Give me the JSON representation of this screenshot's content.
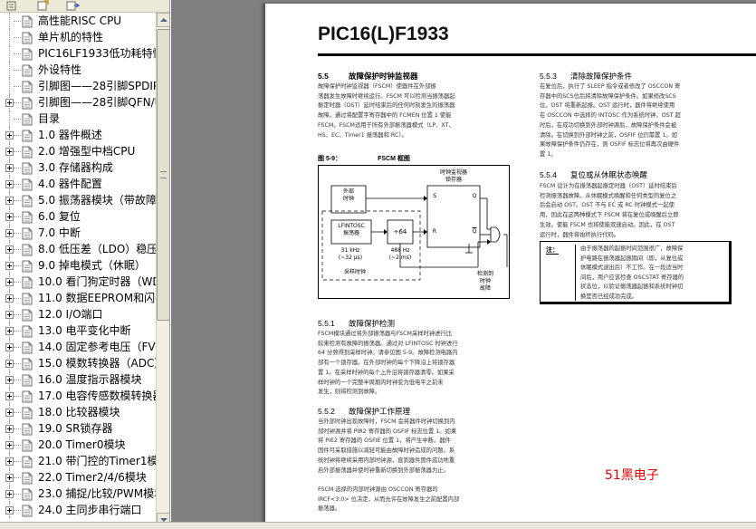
{
  "toolbar": {
    "icons": [
      "bookmark-options-icon",
      "expand-bookmark-icon",
      "new-bookmark-icon"
    ]
  },
  "bookmarks": {
    "items": [
      {
        "label": "高性能RISC CPU",
        "expandable": false
      },
      {
        "label": "单片机的特性",
        "expandable": false
      },
      {
        "label": "PIC16LF1933低功耗特性",
        "expandable": false
      },
      {
        "label": "外设特性",
        "expandable": false
      },
      {
        "label": "引脚图——28引脚SPDIP",
        "expandable": false
      },
      {
        "label": "引脚图——28引脚QFN/U",
        "expandable": true
      },
      {
        "label": "目录",
        "expandable": false
      },
      {
        "label": "1.0 器件概述",
        "expandable": true
      },
      {
        "label": "2.0 增强型中档CPU",
        "expandable": true
      },
      {
        "label": "3.0 存储器构成",
        "expandable": true
      },
      {
        "label": "4.0 器件配置",
        "expandable": true
      },
      {
        "label": "5.0 振荡器模块（带故障",
        "expandable": true
      },
      {
        "label": "6.0 复位",
        "expandable": true
      },
      {
        "label": "7.0 中断",
        "expandable": true
      },
      {
        "label": "8.0 低压差（LDO）稳压",
        "expandable": true
      },
      {
        "label": "9.0 掉电模式（休眠）",
        "expandable": true
      },
      {
        "label": "10.0 看门狗定时器（WD",
        "expandable": true
      },
      {
        "label": "11.0 数据EEPROM和闪存",
        "expandable": true
      },
      {
        "label": "12.0 I/O端口",
        "expandable": true
      },
      {
        "label": "13.0 电平变化中断",
        "expandable": true
      },
      {
        "label": "14.0 固定参考电压（FV",
        "expandable": true
      },
      {
        "label": "15.0 模数转换器（ADC）",
        "expandable": true
      },
      {
        "label": "16.0 温度指示器模块",
        "expandable": true
      },
      {
        "label": "17.0 电容传感数模转换器",
        "expandable": true
      },
      {
        "label": "18.0 比较器模块",
        "expandable": true
      },
      {
        "label": "19.0 SR锁存器",
        "expandable": true
      },
      {
        "label": "20.0 Timer0模块",
        "expandable": true
      },
      {
        "label": "21.0 带门控的Timer1模块",
        "expandable": true
      },
      {
        "label": "22.0 Timer2/4/6模块",
        "expandable": true
      },
      {
        "label": "23.0 捕捉/比较/PWM模块",
        "expandable": true
      },
      {
        "label": "24.0 主同步串行端口",
        "expandable": true
      }
    ]
  },
  "document": {
    "title": "PIC16(L)F1933",
    "sec55": {
      "num": "5.5",
      "title": "故障保护时钟监视器"
    },
    "sec55_text": [
      "故障保护时钟监视器（FSCM）使器件在外部振",
      "荡器发生故障时继续运行。FSCM 可以检测当振荡器起",
      "振定时器（OST）延时结束后的任何时刻发生的振荡器",
      "故障。通过将配置字寄存器中的 FCMEN 位置 1 使能",
      "FSCM。FSCM适用于所有外部振荡器模式（LP、XT、",
      "HS、EC、Timer1 振荡器和 RC）。"
    ],
    "figure": {
      "caption_num": "图 5-9：",
      "caption_title": "FSCM 框图",
      "clock_monitor_latch": "时钟监视器\n锁存器",
      "ext_clock": "外部\n时钟",
      "lfintosc": "LFINTOSC\n振荡器",
      "div64": "÷64",
      "freq1": "31 kHz\n(~32 μs)",
      "freq2": "488 Hz\n(~2 ms)",
      "sample_clock": "采样时钟",
      "detect": "检测到\n时钟\n故障",
      "pin_s": "S",
      "pin_q": "Q",
      "pin_r": "R",
      "pin_qbar": "Q"
    },
    "sec551": {
      "num": "5.5.1",
      "title": "故障保护检测"
    },
    "sec551_text": [
      "FSCM模块通过将外部振荡器与FSCM采样时钟进行比",
      "较来检测有故障的振荡器。通过对 LFINTOSC 时钟进行",
      "64 分频得到采样时钟。请参见图 5-9。故障检测电路内",
      "部有一个锁存器。在外部时钟的每个下降沿上将锁存器",
      "置 1。在采样时钟的每个上升沿将锁存器清零。如果采",
      "样时钟的一个完整半周期内时钟变为低电平之前未",
      "发生，则将检测到故障。"
    ],
    "sec552": {
      "num": "5.5.2",
      "title": "故障保护工作原理"
    },
    "sec552_text": [
      "当外部时钟出现故障时，FSCM 会将器件时钟切换到内",
      "部时钟源并将 PIR2 寄存器的 OSFIF 标志位置 1。如果",
      "将 PIE2 寄存器的 OSFIE 位置 1，将产生中断。器件",
      "固件可采取措施以减轻可能由故障时钟造成的问题。系",
      "统时钟将继续采用内部时钟源，直到器件固件成功地重",
      "启外部振荡器并使时钟重新切换到外部振荡器为止。",
      "",
      "FSCM 选择的内部时钟源由 OSCCON 寄存器的",
      "IRCF<3:0> 位决定，从而允许在故障发生之前配置内部",
      "振荡器。"
    ],
    "sec553": {
      "num": "5.5.3",
      "title": "清除故障保护条件"
    },
    "sec553_text": [
      "在复位后，执行了 SLEEP 指令或者修改了 OSCCON 寄",
      "存器中的SCS位后将清除故障保护条件。如果修改SCS",
      "位，OST 将重新起振。OST 运行时，器件将继续使用",
      "在 OSCCON 中选择的 INTOSC 作为系统时钟。OST 超",
      "时后，在成功切换到外部时钟源后，故障保护条件会被",
      "清除。在切换到外部时钟之前，OSFIF 位仍需置 1。如",
      "果故障保护条件仍存在，则 OSFIF 标志位将再次由硬件",
      "置 1。"
    ],
    "sec554": {
      "num": "5.5.4",
      "title": "复位或从休眠状态唤醒"
    },
    "sec554_text": [
      "FSCM 设计为在振荡器起振定时器（OST）延时结束后",
      "检测振荡器故障。从休眠模式唤醒和任何类型的复位之",
      "后会启动 OST。OST 不与 EC 或 RC 时钟模式一起使",
      "用，因此在这两种模式下 FSCM 将在复位或唤醒后立即",
      "生效。使能 FSCM 也将使能双速启动。因此，在 OST",
      "运行时，器件将始终执行代码。"
    ],
    "note": {
      "label": "注：",
      "lines": [
        "由于振荡器的起振时间范围很广，故障保",
        "护电路在振荡器起振期间（即，从复位或",
        "休眠模式退出后）不工作。在一段适当时",
        "间后，用户应该检查 OSCSTAT 寄存器的",
        "状态位，以验证振荡器起振和系统时钟切",
        "换是否已经成功完成。"
      ]
    },
    "watermark": "51黑电子"
  }
}
